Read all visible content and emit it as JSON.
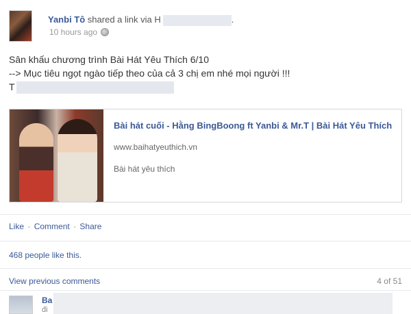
{
  "post": {
    "author": "Yanbi Tô",
    "shared_text": "shared a link via",
    "via_suffix": "H",
    "time": "10 hours ago",
    "message_line1": "Sân khấu chương trình Bài Hát Yêu Thích 6/10",
    "message_line2": "--> Mục tiêu ngọt ngào tiếp theo của cả 3 chị em nhé mọi người !!!",
    "message_line3": "T"
  },
  "link": {
    "title": "Bài hát cuối - Hằng BingBoong ft Yanbi & Mr.T | Bài Hát Yêu Thích",
    "url": "www.baihatyeuthich.vn",
    "description": "Bài hát yêu thích"
  },
  "actions": {
    "like": "Like",
    "comment": "Comment",
    "share": "Share",
    "separator": "·"
  },
  "likes_text": "468 people like this.",
  "comments": {
    "view_previous": "View previous comments",
    "count": "4 of 51",
    "first_name_prefix": "Ba",
    "first_line2_prefix": "đi"
  }
}
